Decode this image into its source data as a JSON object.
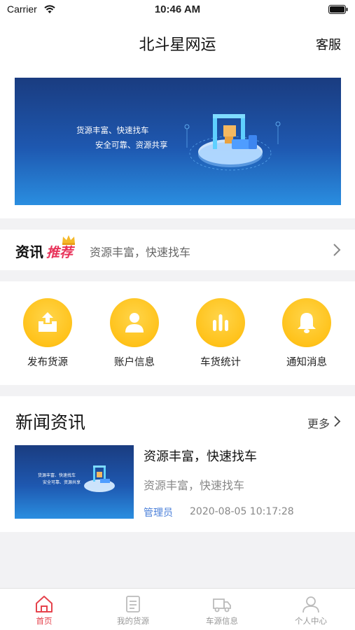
{
  "status_bar": {
    "carrier": "Carrier",
    "time": "10:46 AM",
    "icons": [
      "wifi-icon",
      "battery-icon"
    ]
  },
  "nav": {
    "title": "北斗星网运",
    "action_label": "客服"
  },
  "banner": {
    "line1": "货源丰富、快速找车",
    "line2": "安全可靠、资源共享"
  },
  "info_row": {
    "label": "资讯",
    "label_hot": "推荐",
    "text": "资源丰富，快速找车",
    "icons": [
      "crown-icon",
      "chevron-right-icon"
    ]
  },
  "grid": {
    "items": [
      {
        "label": "发布货源",
        "icon": "upload-box-icon"
      },
      {
        "label": "账户信息",
        "icon": "user-icon"
      },
      {
        "label": "车货统计",
        "icon": "bar-chart-icon"
      },
      {
        "label": "通知消息",
        "icon": "bell-icon"
      }
    ]
  },
  "news": {
    "title": "新闻资讯",
    "more_label": "更多",
    "items": [
      {
        "headline": "资源丰富，快速找车",
        "summary": "资源丰富，快速找车",
        "author": "管理员",
        "date": "2020-08-05 10:17:28",
        "thumb_line1": "货源丰富、快速找车",
        "thumb_line2": "安全可靠、资源共享"
      }
    ]
  },
  "tab_bar": {
    "items": [
      {
        "label": "首页",
        "icon": "home-icon",
        "active": true
      },
      {
        "label": "我的货源",
        "icon": "document-icon",
        "active": false
      },
      {
        "label": "车源信息",
        "icon": "truck-icon",
        "active": false
      },
      {
        "label": "个人中心",
        "icon": "person-icon",
        "active": false
      }
    ]
  },
  "colors": {
    "accent": "#e5434d",
    "grid_icon_bg": "#ffc21a",
    "banner_blue": "#1e58b0",
    "link_blue": "#4a7fd9",
    "hot_red": "#e8335a"
  }
}
